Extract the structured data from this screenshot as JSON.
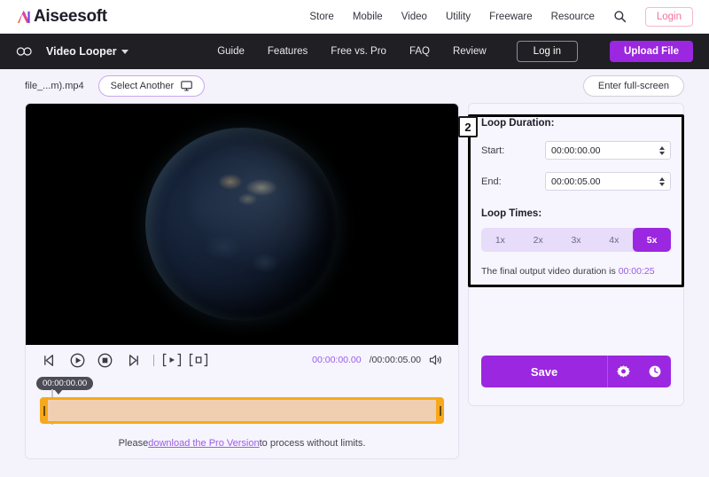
{
  "topbar": {
    "brand": "Aiseesoft",
    "nav": [
      {
        "label": "Store"
      },
      {
        "label": "Mobile"
      },
      {
        "label": "Video"
      },
      {
        "label": "Utility"
      },
      {
        "label": "Freeware"
      },
      {
        "label": "Resource"
      }
    ],
    "search_icon": "search-icon",
    "login_label": "Login",
    "login_border_color": "#f7b8cd"
  },
  "darknav": {
    "loop_icon": "infinity-loop-icon",
    "product": "Video Looper",
    "links": [
      {
        "label": "Guide"
      },
      {
        "label": "Features"
      },
      {
        "label": "Free vs. Pro"
      },
      {
        "label": "FAQ"
      },
      {
        "label": "Review"
      }
    ],
    "login_label": "Log in",
    "upload_label": "Upload File",
    "background": "#1f1f24",
    "accent": "#9b27e0"
  },
  "filebar": {
    "filename": "file_...m).mp4",
    "select_another_label": "Select Another",
    "monitor_icon": "monitor-icon",
    "fullscreen_label": "Enter full-screen"
  },
  "player": {
    "controls": [
      {
        "icon": "previous-frame-icon"
      },
      {
        "icon": "play-icon"
      },
      {
        "icon": "stop-icon"
      },
      {
        "icon": "next-frame-icon"
      }
    ],
    "bracket_controls": [
      {
        "icon": "set-start-marker-icon"
      },
      {
        "icon": "set-end-marker-icon"
      }
    ],
    "current_time": "00:00:00.00",
    "total_time": "/00:00:05.00",
    "volume_icon": "volume-icon",
    "timeline_tooltip": "00:00:00.00",
    "trim_color": "#f7a81b"
  },
  "pro_note": {
    "prefix": "Please ",
    "link": "download the Pro Version",
    "suffix": " to process without limits."
  },
  "panel": {
    "step_badge": "2",
    "loop_duration_title": "Loop Duration:",
    "start_label": "Start:",
    "start_value": "00:00:00.00",
    "end_label": "End:",
    "end_value": "00:00:05.00",
    "loop_times_title": "Loop Times:",
    "loop_options": [
      {
        "label": "1x",
        "active": false
      },
      {
        "label": "2x",
        "active": false
      },
      {
        "label": "3x",
        "active": false
      },
      {
        "label": "4x",
        "active": false
      },
      {
        "label": "5x",
        "active": true
      }
    ],
    "duration_note_prefix": "The final output video duration is ",
    "duration_note_value": "00:00:25",
    "save_label": "Save",
    "gear_icon": "gear-icon",
    "clock_icon": "clock-icon"
  }
}
